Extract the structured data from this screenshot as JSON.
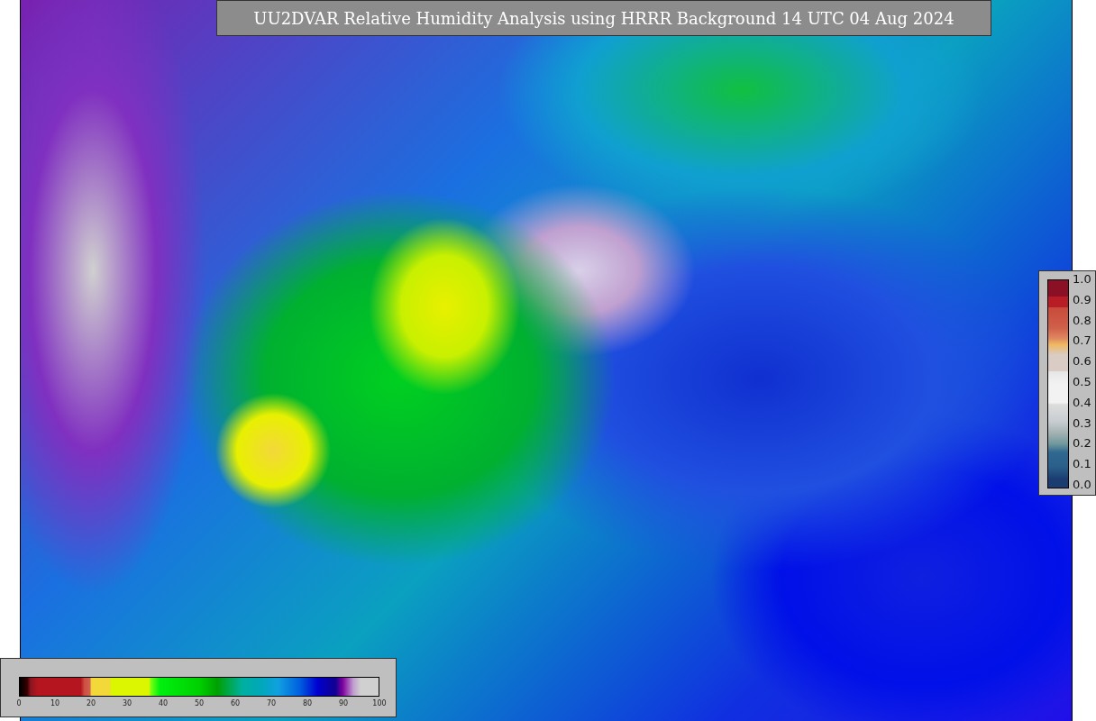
{
  "title": "UU2DVAR Relative Humidity Analysis using HRRR Background 14 UTC 04 Aug 2024",
  "observation_scale": {
    "ticks": [
      "1.0",
      "0.9",
      "0.8",
      "0.7",
      "0.6",
      "0.5",
      "0.4",
      "0.3",
      "0.2",
      "0.1",
      "0.0"
    ]
  },
  "humidity_scale": {
    "ticks": [
      "0",
      "10",
      "20",
      "30",
      "40",
      "50",
      "60",
      "70",
      "80",
      "90",
      "100"
    ]
  }
}
